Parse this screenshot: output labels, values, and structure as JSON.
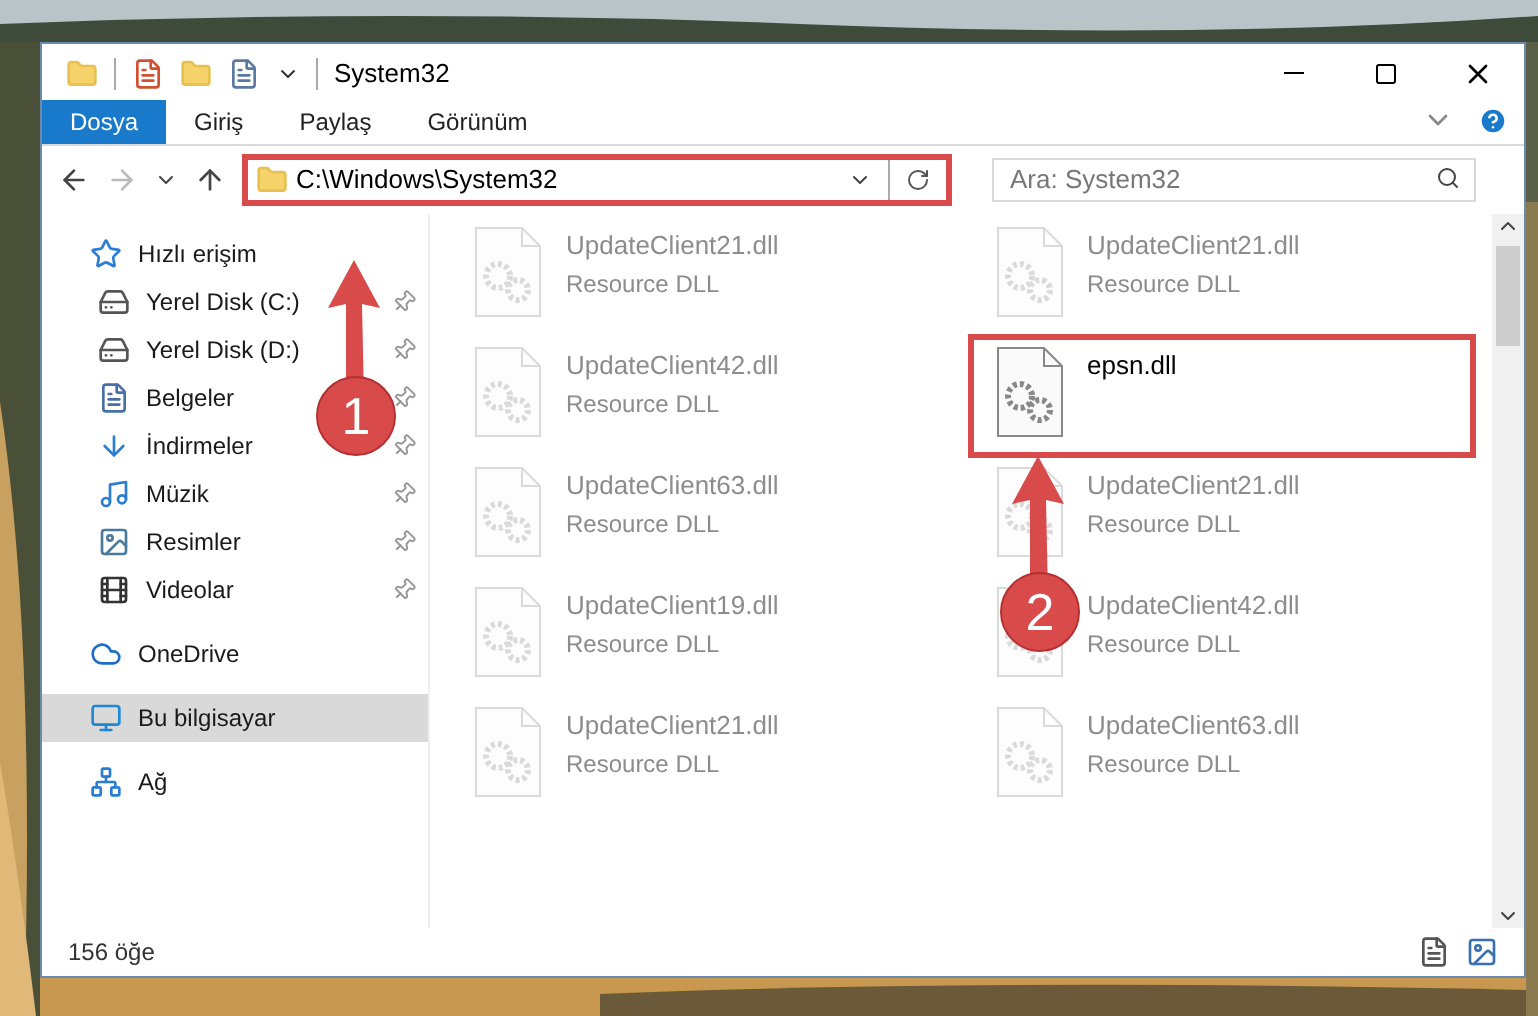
{
  "window": {
    "title": "System32"
  },
  "ribbon_tabs": [
    {
      "label": "Dosya",
      "selected": true
    },
    {
      "label": "Giriş",
      "selected": false
    },
    {
      "label": "Paylaş",
      "selected": false
    },
    {
      "label": "Görünüm",
      "selected": false
    }
  ],
  "address": {
    "path": "C:\\Windows\\System32",
    "highlighted": true
  },
  "search": {
    "placeholder": "Ara: System32"
  },
  "sidebar": {
    "items": [
      {
        "label": "Hızlı erişim",
        "selected": false,
        "children": [
          {
            "label": "Yerel Disk (C:)",
            "pinned": true,
            "selected": false
          },
          {
            "label": "Yerel Disk (D:)",
            "pinned": true,
            "selected": false
          },
          {
            "label": "Belgeler",
            "pinned": true,
            "selected": false
          },
          {
            "label": "İndirmeler",
            "pinned": true,
            "selected": false
          },
          {
            "label": "Müzik",
            "pinned": true,
            "selected": false
          },
          {
            "label": "Resimler",
            "pinned": true,
            "selected": false
          },
          {
            "label": "Videolar",
            "pinned": true,
            "selected": false
          }
        ]
      },
      {
        "label": "OneDrive",
        "selected": false
      },
      {
        "label": "Bu bilgisayar",
        "selected": true
      },
      {
        "label": "Ağ",
        "selected": false
      }
    ]
  },
  "files": [
    {
      "name": "UpdateClient21.dll",
      "type": "Resource DLL",
      "faded": true
    },
    {
      "name": "UpdateClient21.dll",
      "type": "Resource DLL",
      "faded": true
    },
    {
      "name": "UpdateClient42.dll",
      "type": "Resource DLL",
      "faded": true
    },
    {
      "name": "epsn.dll",
      "faded": false,
      "highlighted": true
    },
    {
      "name": "UpdateClient63.dll",
      "type": "Resource DLL",
      "faded": true
    },
    {
      "name": "UpdateClient21.dll",
      "type": "Resource DLL",
      "faded": true
    },
    {
      "name": "UpdateClient19.dll",
      "type": "Resource DLL",
      "faded": true
    },
    {
      "name": "UpdateClient42.dll",
      "type": "Resource DLL",
      "faded": true
    },
    {
      "name": "UpdateClient21.dll",
      "type": "Resource DLL",
      "faded": true
    },
    {
      "name": "UpdateClient63.dll",
      "type": "Resource DLL",
      "faded": true
    }
  ],
  "status_bar": {
    "count": "156 öğe"
  },
  "annotations": [
    {
      "number": "1"
    },
    {
      "number": "2"
    }
  ]
}
